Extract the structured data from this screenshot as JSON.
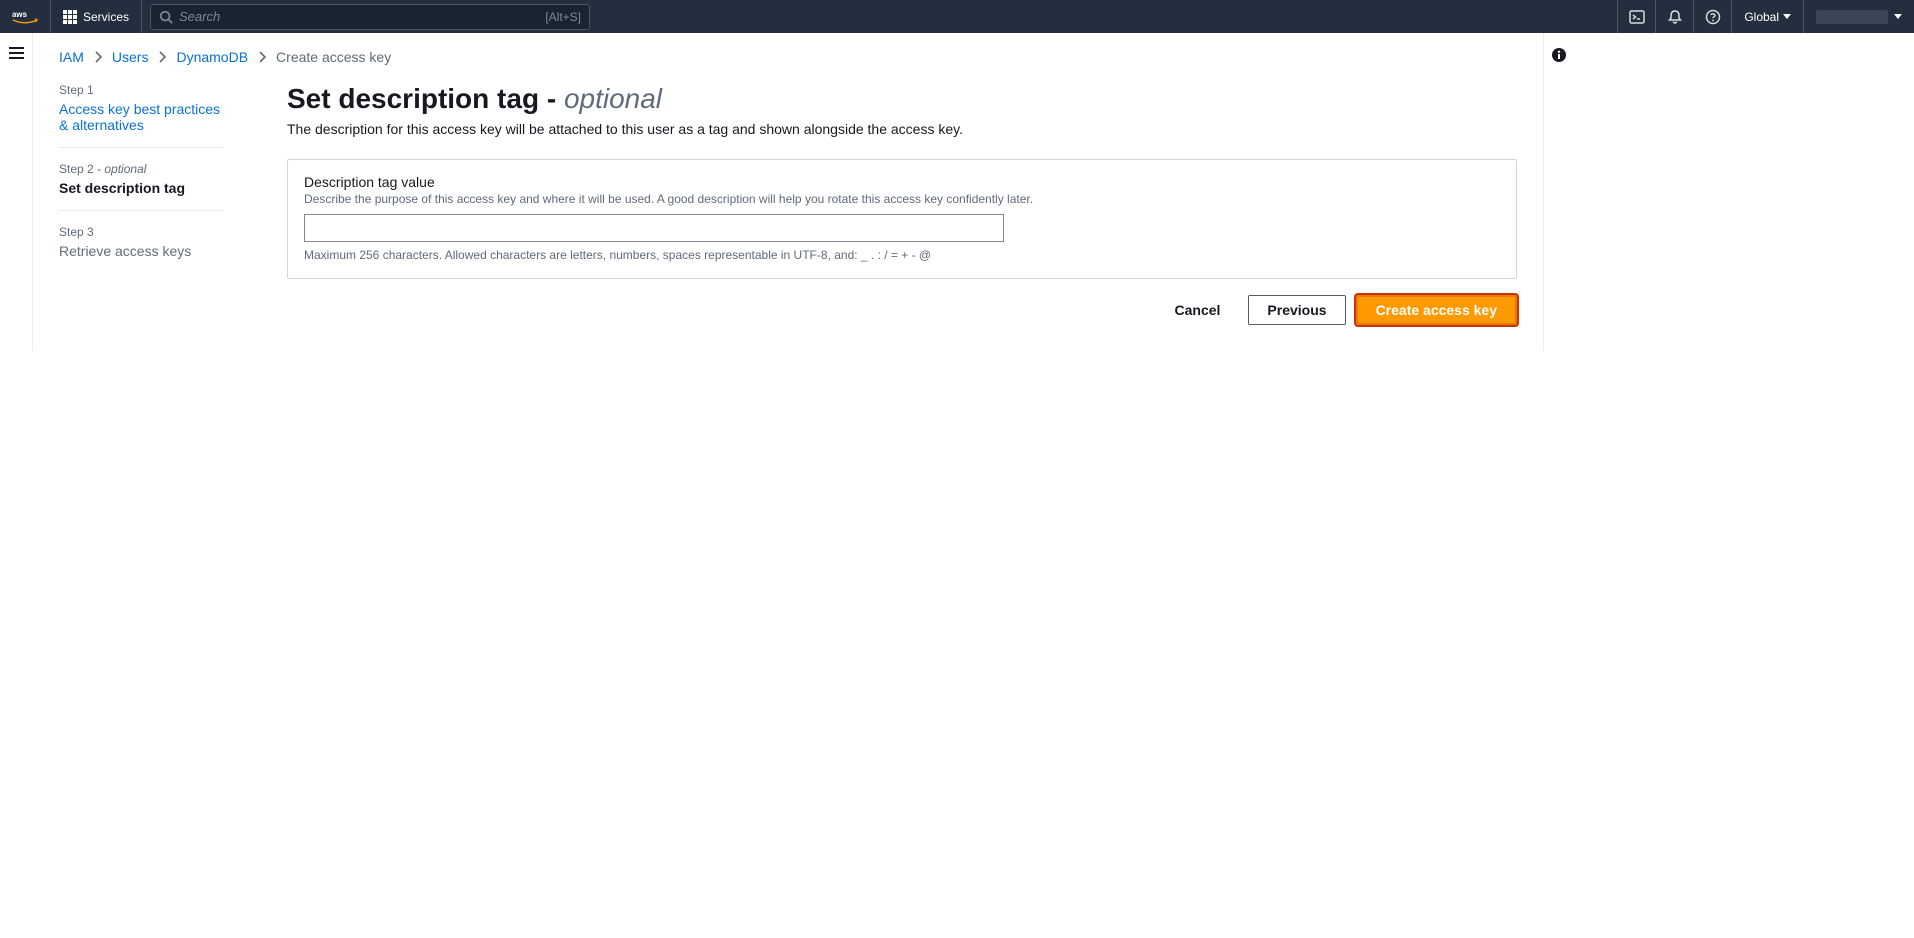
{
  "topnav": {
    "services_label": "Services",
    "search_placeholder": "Search",
    "search_shortcut": "[Alt+S]",
    "region": "Global"
  },
  "breadcrumb": {
    "items": [
      {
        "label": "IAM",
        "link": true
      },
      {
        "label": "Users",
        "link": true
      },
      {
        "label": "DynamoDB",
        "link": true
      },
      {
        "label": "Create access key",
        "link": false
      }
    ]
  },
  "wizard_steps": [
    {
      "label": "Step 1",
      "optional": false,
      "title": "Access key best practices & alternatives",
      "state": "link"
    },
    {
      "label": "Step 2",
      "optional": true,
      "title": "Set description tag",
      "state": "active"
    },
    {
      "label": "Step 3",
      "optional": false,
      "title": "Retrieve access keys",
      "state": "future"
    }
  ],
  "page": {
    "title_main": "Set description tag",
    "title_sep": " - ",
    "title_optional": "optional",
    "subtitle": "The description for this access key will be attached to this user as a tag and shown alongside the access key."
  },
  "form": {
    "field_label": "Description tag value",
    "field_desc": "Describe the purpose of this access key and where it will be used. A good description will help you rotate this access key confidently later.",
    "field_value": "",
    "constraint": "Maximum 256 characters. Allowed characters are letters, numbers, spaces representable in UTF-8, and: _ . : / = + - @"
  },
  "actions": {
    "cancel": "Cancel",
    "previous": "Previous",
    "create": "Create access key"
  }
}
